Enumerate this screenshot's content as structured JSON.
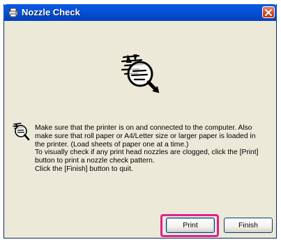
{
  "window": {
    "title": "Nozzle Check",
    "title_icon": "printer-wizard-icon",
    "close_icon": "close-icon"
  },
  "content": {
    "hero_icon": "nozzle-check-magnifier-icon",
    "message_icon": "nozzle-check-magnifier-icon",
    "message_lines": [
      "Make sure that the printer is on and connected to the computer. Also",
      "make sure that roll paper or A4/Letter size or larger paper is loaded in",
      "the printer. (Load sheets of paper one at a time.)",
      "To visually check if any print head nozzles are clogged, click the [Print]",
      "button to print a nozzle check pattern.",
      "Click the [Finish] button to quit."
    ]
  },
  "buttons": {
    "print_label": "Print",
    "finish_label": "Finish"
  },
  "colors": {
    "titlebar": "#0553d8",
    "window_bg": "#ece9d8",
    "close_button": "#d44625",
    "focus_highlight": "#e0218a"
  }
}
